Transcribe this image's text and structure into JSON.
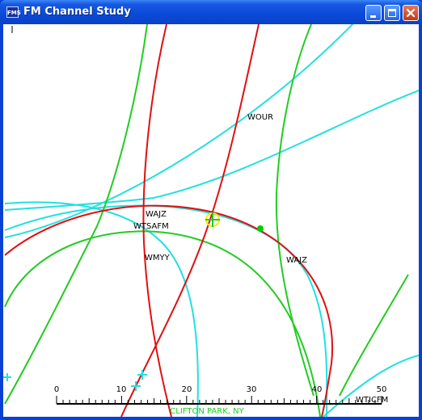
{
  "window": {
    "title": "FM Channel Study",
    "app_icon_text": "FMS",
    "controls": {
      "minimize": "minimize-icon",
      "maximize": "maximize-icon",
      "close": "close-icon"
    }
  },
  "map": {
    "station_labels": [
      {
        "name": "WOUR"
      },
      {
        "name": "WAJZ"
      },
      {
        "name": "WTSAFM"
      },
      {
        "name": "WMYY"
      },
      {
        "name": "WAJZ"
      },
      {
        "name": "WTICFM"
      }
    ],
    "colors": {
      "red_contour": "#e01010",
      "green_contour": "#22cc22",
      "cyan_contour": "#22e0e0",
      "marker_yellow": "#f0f000",
      "marker_green": "#00cc00",
      "location_label": "#22cc22"
    },
    "location_label": "CLIFTON PARK, NY",
    "scale": {
      "labels": [
        "0",
        "10",
        "20",
        "30",
        "40",
        "50"
      ]
    }
  }
}
